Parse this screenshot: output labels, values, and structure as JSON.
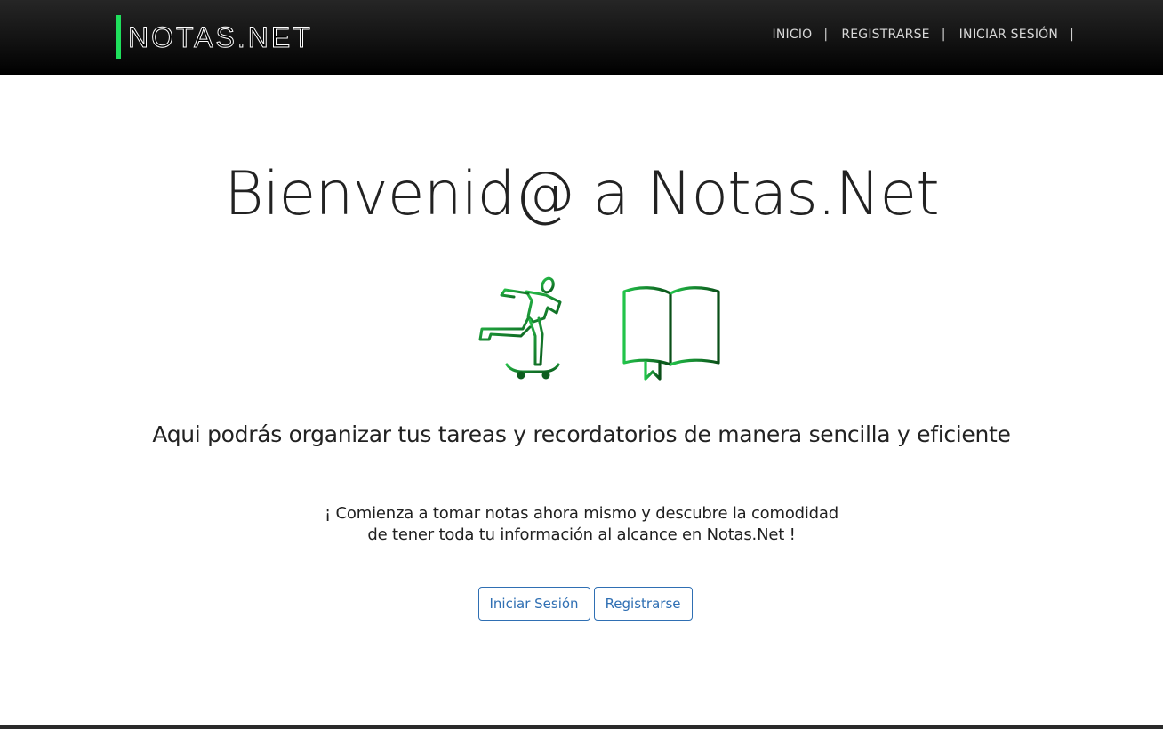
{
  "navbar": {
    "brand": "NOTAS.NET",
    "links": [
      {
        "label": "INICIO",
        "separator": "|"
      },
      {
        "label": "REGISTRARSE",
        "separator": "|"
      },
      {
        "label": "INICIAR SESIÓN",
        "separator": "|"
      }
    ],
    "accent_color": "#1fe05c"
  },
  "hero": {
    "title": "Bienvenid@ a Notas.Net",
    "illustrations": [
      "skateboarder-icon",
      "open-book-icon"
    ],
    "illustration_color": "#1a9a32",
    "subtitle": "Aqui podrás organizar tus tareas y recordatorios de manera sencilla y eficiente",
    "lead_line1": "¡ Comienza a tomar notas ahora mismo y descubre la comodidad",
    "lead_line2": "de tener toda tu información al alcance en Notas.Net !"
  },
  "actions": {
    "login_label": "Iniciar Sesión",
    "register_label": "Registrarse",
    "button_color": "#2f6fb3"
  }
}
